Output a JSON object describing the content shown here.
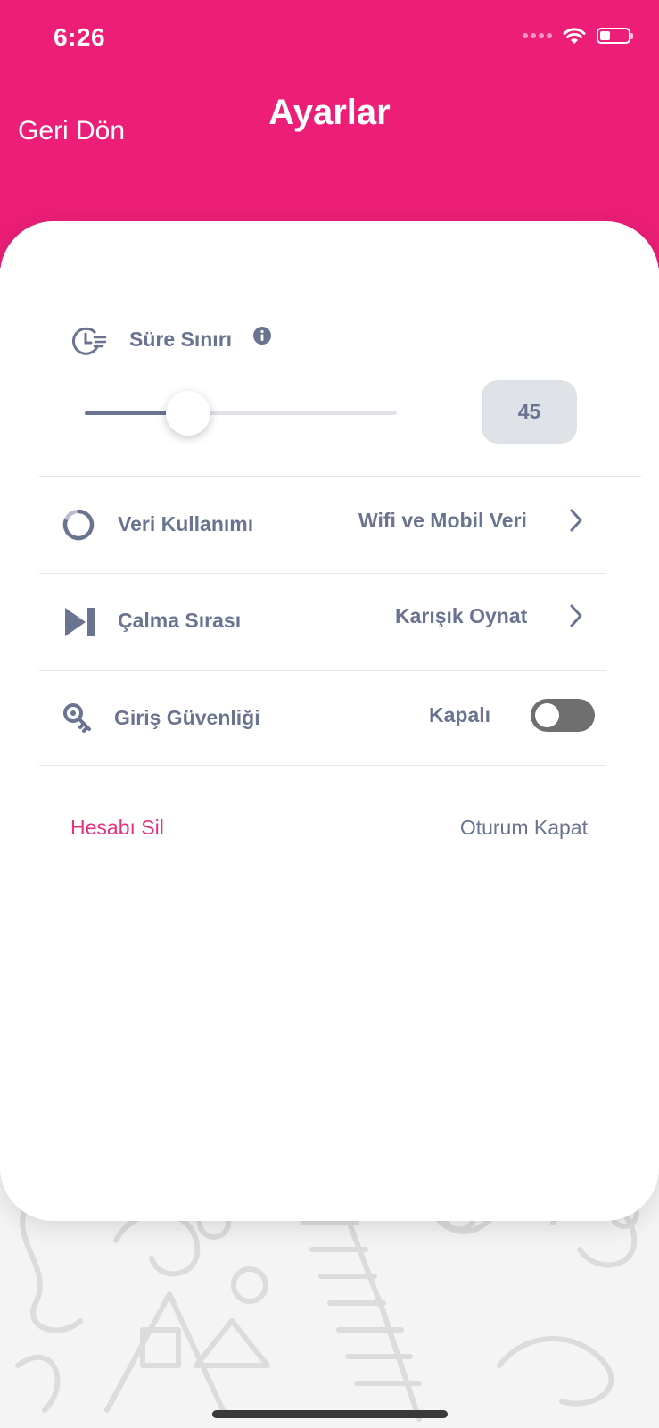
{
  "status_bar": {
    "time": "6:26",
    "icons": [
      "signal-dots-icon",
      "wifi-icon",
      "battery-icon"
    ],
    "battery_level": 0.3
  },
  "header": {
    "back_label": "Geri Dön",
    "title": "Ayarlar",
    "color": "#ec1e78"
  },
  "settings": {
    "time_limit": {
      "label": "Süre Sınırı",
      "icon": "clock-list-icon",
      "info_icon": "info-icon",
      "slider_value": 45,
      "slider_fraction": 0.33,
      "value_text": "45"
    },
    "data_usage": {
      "label": "Veri Kullanımı",
      "icon": "progress-ring-icon",
      "value": "Wifi ve Mobil Veri"
    },
    "play_order": {
      "label": "Çalma Sırası",
      "icon": "skip-next-icon",
      "value": "Karışık Oynat"
    },
    "login_security": {
      "label": "Giriş Güvenliği",
      "icon": "key-search-icon",
      "value": "Kapalı",
      "enabled": false
    }
  },
  "actions": {
    "delete_account": "Hesabı Sil",
    "logout": "Oturum Kapat"
  },
  "colors": {
    "accent": "#ec1e78",
    "text": "#6a7490",
    "delete": "#e8317e"
  }
}
